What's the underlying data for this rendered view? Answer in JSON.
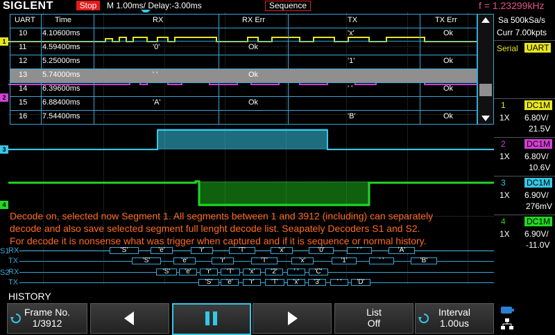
{
  "header": {
    "brand": "SIGLENT",
    "run_status": "Stop",
    "timebase": "M 1.00ms/ Delay:-3.00ms",
    "mode": "Sequence",
    "frequency": "f = 1.23299kHz"
  },
  "right_panel": {
    "sample_rate": "Sa 500kSa/s",
    "memory": "Curr 7.00kpts",
    "decode_label": "Serial",
    "decode_protocol": "UART",
    "channels": [
      {
        "num": "1",
        "coupling": "DC1M",
        "probe": "1X",
        "scale": "6.80V/",
        "offset": "21.5V",
        "color": "#e8e61c"
      },
      {
        "num": "2",
        "coupling": "DC1M",
        "probe": "1X",
        "scale": "6.80V/",
        "offset": "10.6V",
        "color": "#d43fd4"
      },
      {
        "num": "3",
        "coupling": "DC1M",
        "probe": "1X",
        "scale": "6.90V/",
        "offset": "276mV",
        "color": "#35c7e6"
      },
      {
        "num": "4",
        "coupling": "DC1M",
        "probe": "1X",
        "scale": "6.90V/",
        "offset": "-11.0V",
        "color": "#22d822"
      }
    ]
  },
  "table": {
    "headers": [
      "UART",
      "Time",
      "RX",
      "RX Err",
      "TX",
      "TX Err"
    ],
    "rows": [
      {
        "n": "10",
        "time": "4.10600ms",
        "rx": "",
        "rx_err": "",
        "tx": "'x'",
        "tx_err": "Ok"
      },
      {
        "n": "11",
        "time": "4.59400ms",
        "rx": "'0'",
        "rx_err": "Ok",
        "tx": "",
        "tx_err": ""
      },
      {
        "n": "12",
        "time": "5.25000ms",
        "rx": "",
        "rx_err": "",
        "tx": "'1'",
        "tx_err": "Ok"
      },
      {
        "n": "13",
        "time": "5.74000ms",
        "rx": "' '",
        "rx_err": "Ok",
        "tx": "",
        "tx_err": ""
      },
      {
        "n": "14",
        "time": "6.39600ms",
        "rx": "",
        "rx_err": "",
        "tx": "' '",
        "tx_err": "Ok"
      },
      {
        "n": "15",
        "time": "6.88400ms",
        "rx": "'A'",
        "rx_err": "Ok",
        "tx": "",
        "tx_err": ""
      },
      {
        "n": "16",
        "time": "7.54400ms",
        "rx": "",
        "rx_err": "",
        "tx": "'B'",
        "tx_err": "Ok"
      }
    ]
  },
  "annotation": {
    "line1": "Decode on, selected now Segment 1.  All segments between 1 and 3912 (including) can separately",
    "line2": "decode and also save selected segment full lenght decode list. Seapately Decoders  S1 and S2.",
    "line3": "For decode it is nonsense what was trigger when captured and if it is sequence or normal history."
  },
  "bus": {
    "s1_label": "S1",
    "s2_label": "S2",
    "rx_label": "RX",
    "tx_label": "TX",
    "s1_rx": [
      "'S'",
      "'e'",
      "'r'",
      "'T'",
      "'x'",
      "'0'",
      "' '",
      "'A'"
    ],
    "s1_tx": [
      "'S'",
      "'e'",
      "'r'",
      "'T'",
      "'x'",
      "'1'",
      "' '",
      "'B'"
    ],
    "s2_rx": [
      "'S'",
      "'e'",
      "'r'",
      "'T'",
      "'x'",
      "'2'",
      "' '",
      "'C'"
    ],
    "s2_tx": [
      "'S'",
      "'e'",
      "'r'",
      "'T'",
      "'x'",
      "'3'",
      "' '",
      "'D'"
    ]
  },
  "history": {
    "title": "HISTORY",
    "frame_label": "Frame No.",
    "frame_value": "1/3912",
    "list_label": "List",
    "list_value": "Off",
    "interval_label": "Interval",
    "interval_value": "1.00us"
  },
  "markers": {
    "ch1": "1",
    "ch2": "2",
    "ch3": "3",
    "ch4": "4"
  }
}
